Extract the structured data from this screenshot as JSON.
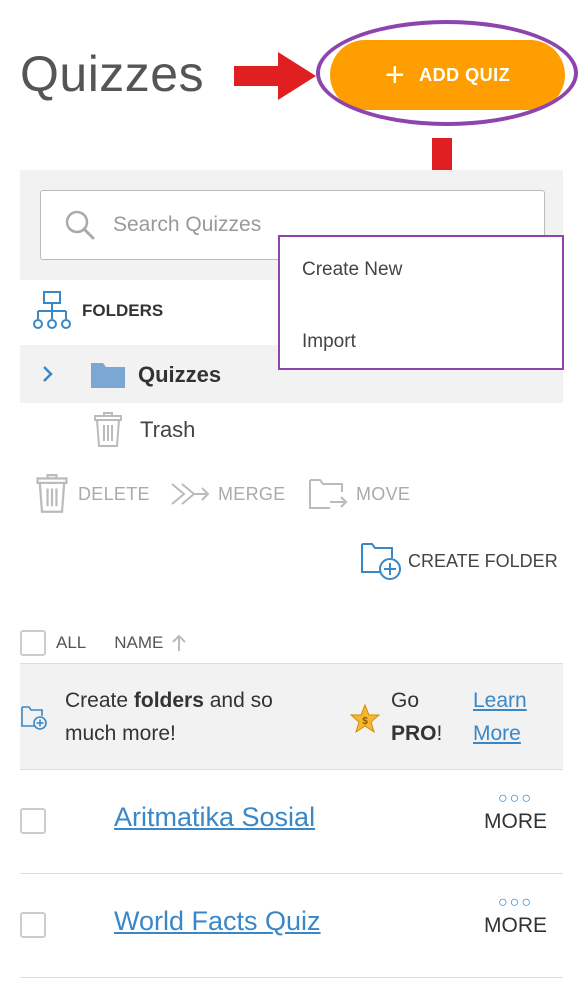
{
  "header": {
    "title": "Quizzes",
    "add_quiz_label": "ADD QUIZ"
  },
  "search": {
    "placeholder": "Search Quizzes"
  },
  "dropdown": {
    "items": [
      {
        "label": "Create New"
      },
      {
        "label": "Import"
      }
    ]
  },
  "folders": {
    "heading": "FOLDERS",
    "items": [
      {
        "label": "Quizzes"
      },
      {
        "label": "Trash"
      }
    ]
  },
  "actions": {
    "delete": "DELETE",
    "merge": "MERGE",
    "move": "MOVE",
    "create_folder": "CREATE FOLDER"
  },
  "list": {
    "all_label": "ALL",
    "name_label": "NAME"
  },
  "promo": {
    "text_a": "Create ",
    "text_bold": "folders",
    "text_b": " and so",
    "text_c": "much more!",
    "go": "Go",
    "pro": "PRO",
    "excl": "!",
    "learn_1": "Learn",
    "learn_2": "More"
  },
  "quizzes": [
    {
      "name": "Aritmatika Sosial",
      "more_label": "MORE"
    },
    {
      "name": "World Facts Quiz",
      "more_label": "MORE"
    }
  ],
  "colors": {
    "accent": "#ff9e00",
    "link": "#3a87c8",
    "highlight": "#8e44ad",
    "arrow": "#e02020"
  }
}
